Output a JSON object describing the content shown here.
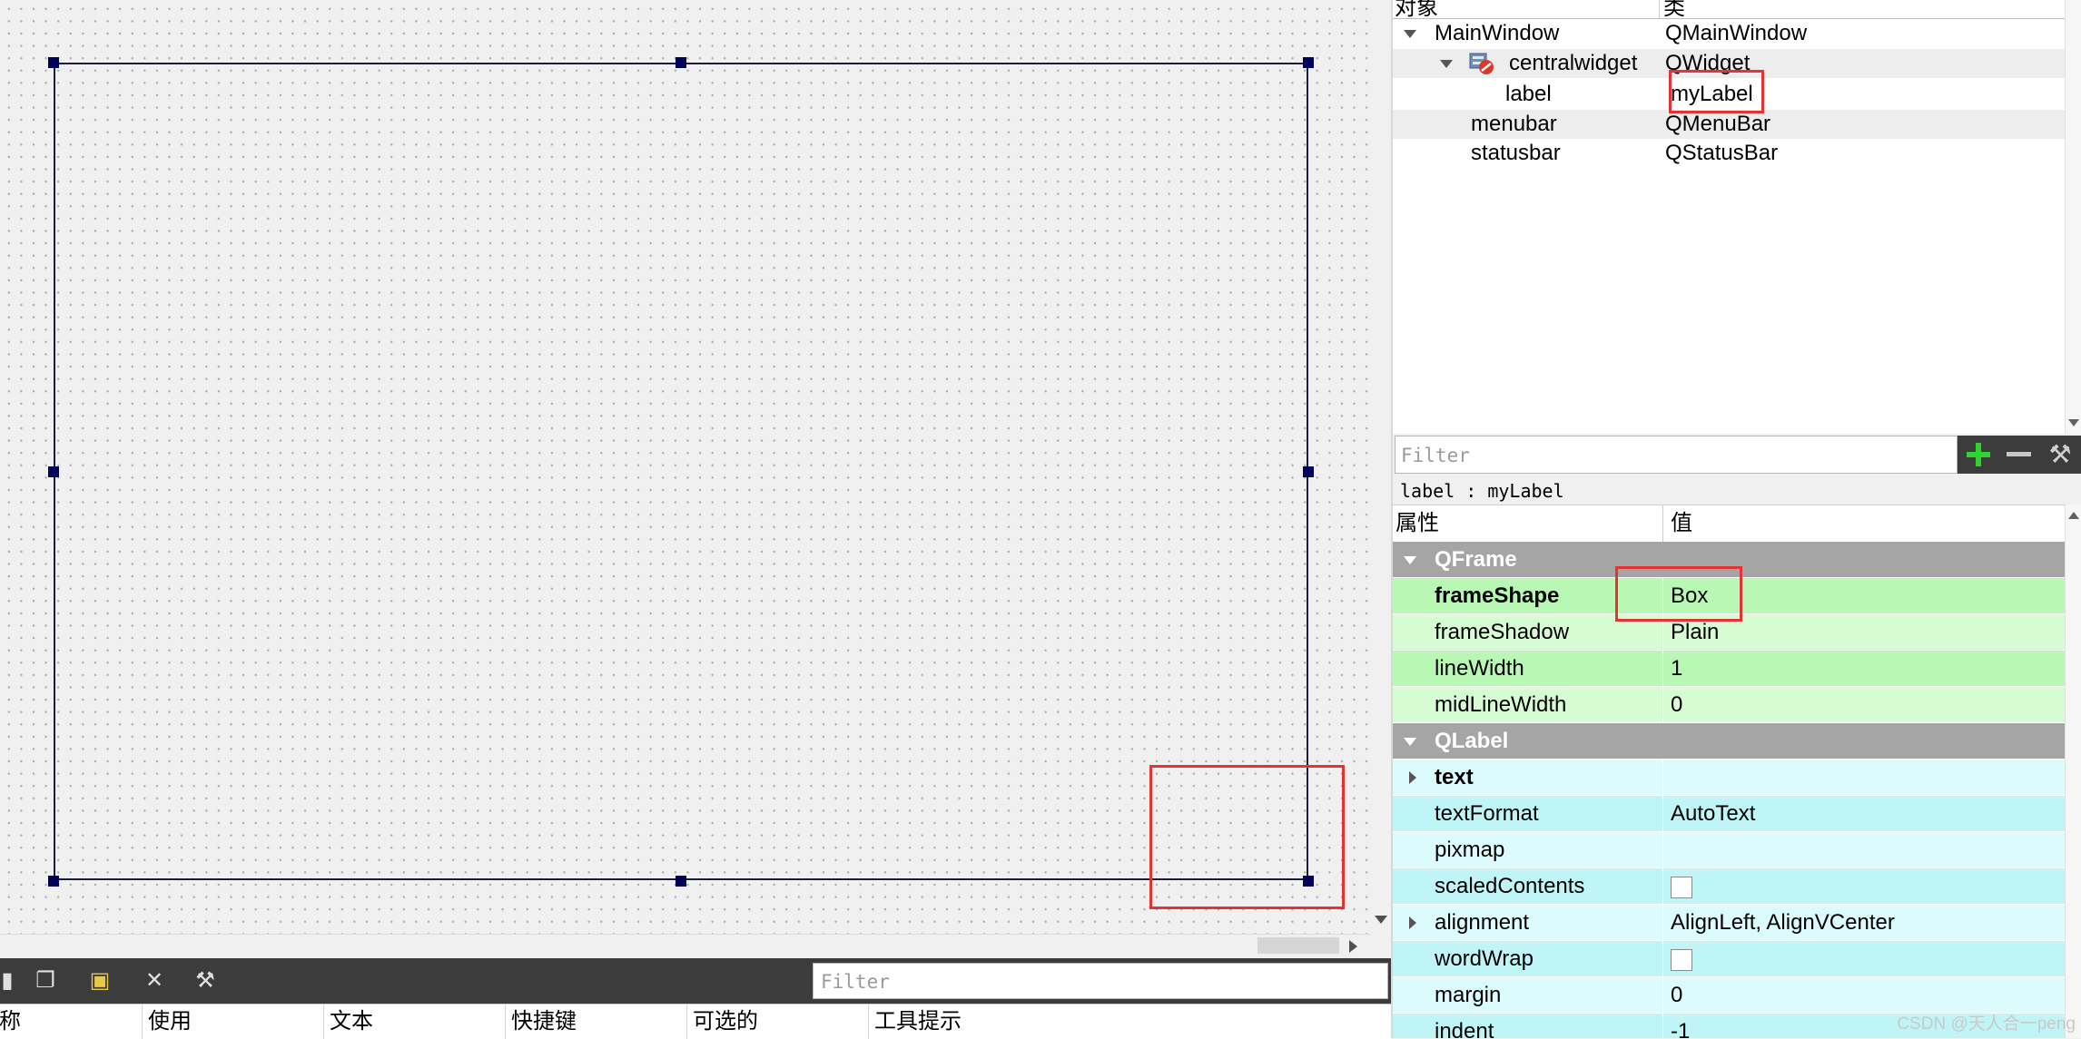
{
  "action_editor": {
    "filter_placeholder": "Filter",
    "toolbar_icons": [
      "new-action-icon",
      "copy-icon",
      "paste-icon",
      "delete-icon",
      "configure-icon"
    ],
    "columns": [
      "称",
      "使用",
      "文本",
      "快捷键",
      "可选的",
      "工具提示"
    ]
  },
  "object_inspector": {
    "headers": {
      "object": "对象",
      "class": "类"
    },
    "rows": [
      {
        "name": "MainWindow",
        "class": "QMainWindow"
      },
      {
        "name": "centralwidget",
        "class": "QWidget"
      },
      {
        "name": "label",
        "class": "myLabel"
      },
      {
        "name": "menubar",
        "class": "QMenuBar"
      },
      {
        "name": "statusbar",
        "class": "QStatusBar"
      }
    ]
  },
  "property_editor": {
    "filter_placeholder": "Filter",
    "object_title": "label : myLabel",
    "headers": {
      "property": "属性",
      "value": "值"
    },
    "groups": [
      {
        "name": "QFrame",
        "props": [
          {
            "name": "frameShape",
            "value": "Box",
            "bold": true
          },
          {
            "name": "frameShadow",
            "value": "Plain"
          },
          {
            "name": "lineWidth",
            "value": "1"
          },
          {
            "name": "midLineWidth",
            "value": "0"
          }
        ]
      },
      {
        "name": "QLabel",
        "props": [
          {
            "name": "text",
            "value": "",
            "bold": true
          },
          {
            "name": "textFormat",
            "value": "AutoText"
          },
          {
            "name": "pixmap",
            "value": ""
          },
          {
            "name": "scaledContents",
            "value": "",
            "checked": false
          },
          {
            "name": "alignment",
            "value": "AlignLeft, AlignVCenter"
          },
          {
            "name": "wordWrap",
            "value": "",
            "checked": false
          },
          {
            "name": "margin",
            "value": "0"
          },
          {
            "name": "indent",
            "value": "-1"
          }
        ]
      }
    ]
  },
  "watermark": "CSDN @天人合一peng",
  "colors": {
    "highlight_red": "#e53232",
    "qframe_green": "#b9f7b4",
    "qlabel_cyan": "#bff5f7",
    "group_gray": "#a5a5a5",
    "handle_navy": "#00005a"
  }
}
